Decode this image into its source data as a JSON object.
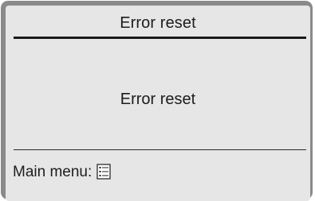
{
  "header": {
    "title": "Error reset"
  },
  "content": {
    "message": "Error reset"
  },
  "footer": {
    "label": "Main menu:",
    "icon": "menu-list-icon"
  }
}
